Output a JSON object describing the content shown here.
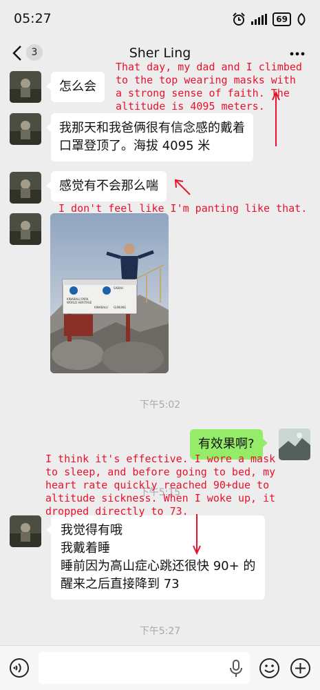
{
  "status_bar": {
    "time": "05:27",
    "battery": "69"
  },
  "header": {
    "unread_count": "3",
    "title": "Sher Ling"
  },
  "messages": {
    "m1": "怎么会",
    "m2": [
      "我那天和我爸俩很有信念感的戴着",
      "口罩登顶了。海拔 4095 米"
    ],
    "m3": "感觉有不会那么喘",
    "m4": "有效果啊?",
    "m5": [
      "我觉得有哦",
      "我戴着睡",
      "睡前因为高山症心跳还很快 90+ 的",
      "醒来之后直接降到 73"
    ]
  },
  "photo_sign": {
    "left_title": "KINABALU PARK",
    "left_sub": "WORLD HERITAGE",
    "right_title": "SABAH",
    "bottom_left": "KINABALU",
    "bottom_right": "GUNUNG"
  },
  "timestamps": {
    "t1": "下午5:02",
    "t2": "下午5:15",
    "t3": "下午5:27"
  },
  "annotations": {
    "a1": [
      "That day, my dad and I climbed",
      "to the top wearing masks with",
      "a strong sense of faith. The",
      "altitude is 4095 meters."
    ],
    "a2": "I don't feel like I'm panting like that.",
    "a3": [
      "I think it's effective. I wore a mask",
      "to sleep, and before going to bed, my",
      "heart rate quickly reached 90+due to",
      "altitude sickness. When I woke up, it",
      "dropped directly to 73."
    ]
  },
  "input": {
    "placeholder": ""
  },
  "colors": {
    "bubble_sent": "#95ec69",
    "annotation": "#e8112d",
    "background": "#ededed"
  }
}
